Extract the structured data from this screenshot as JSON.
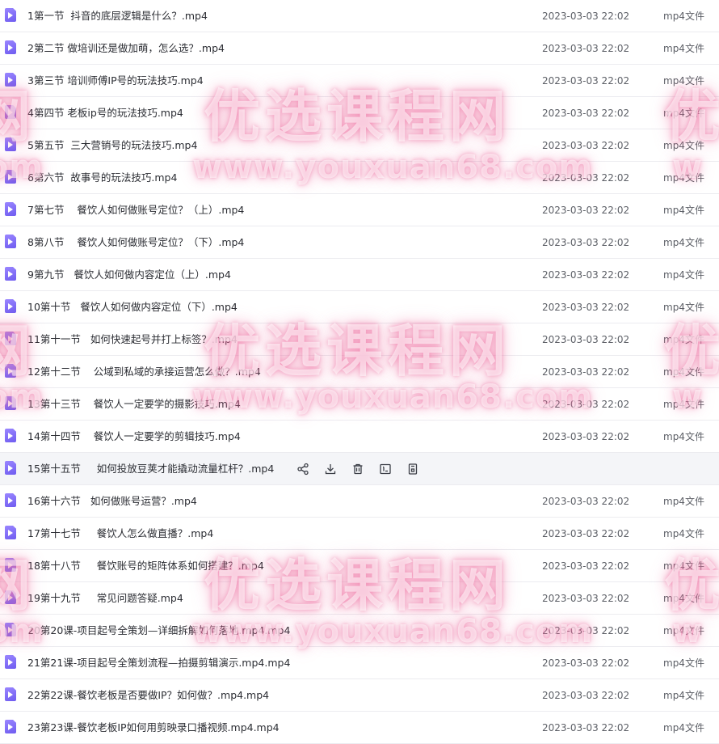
{
  "files": [
    {
      "name": "1第一节  抖音的底层逻辑是什么？.mp4",
      "date": "2023-03-03 22:02",
      "type": "mp4文件"
    },
    {
      "name": "2第二节 做培训还是做加萌，怎么选？.mp4",
      "date": "2023-03-03 22:02",
      "type": "mp4文件"
    },
    {
      "name": "3第三节 培训师傅IP号的玩法技巧.mp4",
      "date": "2023-03-03 22:02",
      "type": "mp4文件"
    },
    {
      "name": "4第四节 老板ip号的玩法技巧.mp4",
      "date": "2023-03-03 22:02",
      "type": "mp4文件"
    },
    {
      "name": "5第五节  三大营销号的玩法技巧.mp4",
      "date": "2023-03-03 22:02",
      "type": "mp4文件"
    },
    {
      "name": "6第六节  故事号的玩法技巧.mp4",
      "date": "2023-03-03 22:02",
      "type": "mp4文件"
    },
    {
      "name": "7第七节    餐饮人如何做账号定位？（上）.mp4",
      "date": "2023-03-03 22:02",
      "type": "mp4文件"
    },
    {
      "name": "8第八节    餐饮人如何做账号定位？（下）.mp4",
      "date": "2023-03-03 22:02",
      "type": "mp4文件"
    },
    {
      "name": "9第九节   餐饮人如何做内容定位（上）.mp4",
      "date": "2023-03-03 22:02",
      "type": "mp4文件"
    },
    {
      "name": "10第十节   餐饮人如何做内容定位（下）.mp4",
      "date": "2023-03-03 22:02",
      "type": "mp4文件"
    },
    {
      "name": "11第十一节   如何快速起号并打上标签？.mp4",
      "date": "2023-03-03 22:02",
      "type": "mp4文件"
    },
    {
      "name": "12第十二节    公域到私域的承接运营怎么做？.mp4",
      "date": "2023-03-03 22:02",
      "type": "mp4文件"
    },
    {
      "name": "13第十三节    餐饮人一定要学的摄影技巧.mp4",
      "date": "2023-03-03 22:02",
      "type": "mp4文件"
    },
    {
      "name": "14第十四节    餐饮人一定要学的剪辑技巧.mp4",
      "date": "2023-03-03 22:02",
      "type": "mp4文件"
    },
    {
      "name": "15第十五节     如何投放豆荚才能撬动流量杠杆？.mp4",
      "date": "",
      "type": ""
    },
    {
      "name": "16第十六节   如何做账号运营？.mp4",
      "date": "2023-03-03 22:02",
      "type": "mp4文件"
    },
    {
      "name": "17第十七节     餐饮人怎么做直播？.mp4",
      "date": "2023-03-03 22:02",
      "type": "mp4文件"
    },
    {
      "name": "18第十八节     餐饮账号的矩阵体系如何搭建？.mp4",
      "date": "2023-03-03 22:02",
      "type": "mp4文件"
    },
    {
      "name": "19第十九节     常见问题答疑.mp4",
      "date": "2023-03-03 22:02",
      "type": "mp4文件"
    },
    {
      "name": "20第20课-项目起号全策划—详细拆解如何落地.mp4.mp4",
      "date": "2023-03-03 22:02",
      "type": "mp4文件"
    },
    {
      "name": "21第21课-项目起号全策划流程—拍摄剪辑演示.mp4.mp4",
      "date": "2023-03-03 22:02",
      "type": "mp4文件"
    },
    {
      "name": "22第22课-餐饮老板是否要做IP？如何做？.mp4.mp4",
      "date": "2023-03-03 22:02",
      "type": "mp4文件"
    },
    {
      "name": "23第23课-餐饮老板IP如何用剪映录口播视频.mp4.mp4",
      "date": "2023-03-03 22:02",
      "type": "mp4文件"
    }
  ],
  "hovered_row_index": 14,
  "row_actions": [
    "share-icon",
    "download-icon",
    "delete-icon",
    "rename-icon",
    "copy-icon"
  ],
  "watermark": {
    "cn": "优选课程网",
    "cn_fragment_left": "网",
    "cn_fragment_right": "优",
    "url": "www.youxuan68.com",
    "url_fragment_left": "com",
    "url_fragment_right": "w"
  },
  "colors": {
    "file_icon": "#7b68ee",
    "row_hover_bg": "#f4f5f8",
    "watermark_glow": "#ee6ea0"
  }
}
